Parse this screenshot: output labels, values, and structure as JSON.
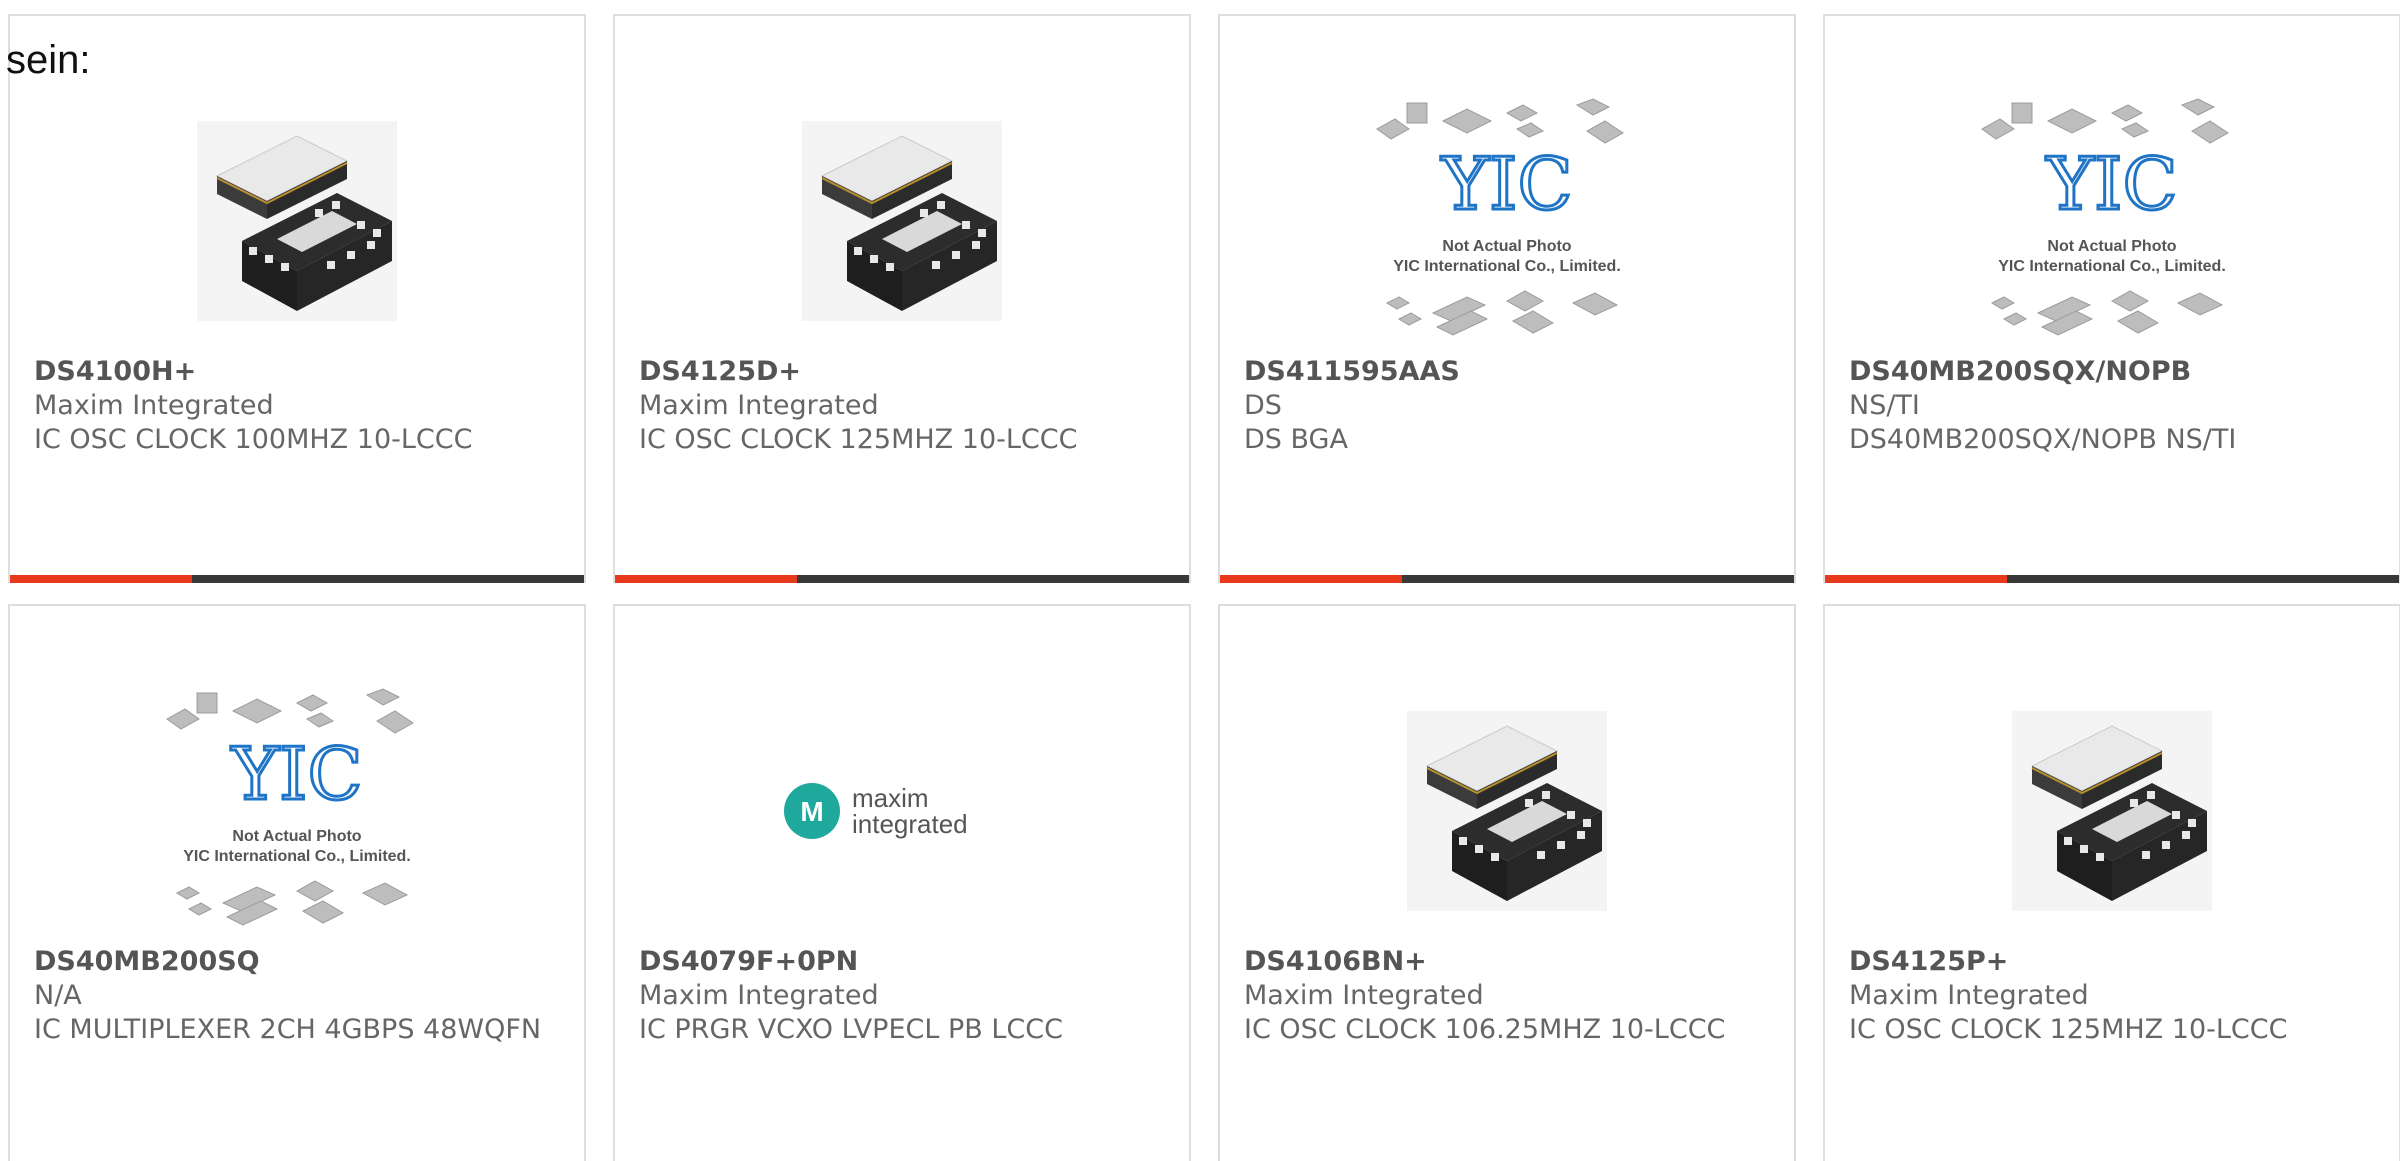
{
  "intro_text": "sein:",
  "products": [
    {
      "part": "DS4100H+",
      "maker": "Maxim Integrated",
      "desc": "IC OSC CLOCK 100MHZ 10-LCCC",
      "image": "chip-lccc"
    },
    {
      "part": "DS4125D+",
      "maker": "Maxim Integrated",
      "desc": "IC OSC CLOCK 125MHZ 10-LCCC",
      "image": "chip-lccc"
    },
    {
      "part": "DS411595AAS",
      "maker": "DS",
      "desc": "DS BGA",
      "image": "yic-placeholder",
      "caption1": "Not Actual Photo",
      "caption2": "YIC International Co., Limited."
    },
    {
      "part": "DS40MB200SQX/NOPB",
      "maker": "NS/TI",
      "desc": "DS40MB200SQX/NOPB NS/TI",
      "image": "yic-placeholder",
      "caption1": "Not Actual Photo",
      "caption2": "YIC International Co., Limited."
    },
    {
      "part": "DS40MB200SQ",
      "maker": "N/A",
      "desc": "IC MULTIPLEXER 2CH 4GBPS 48WQFN",
      "image": "yic-placeholder",
      "caption1": "Not Actual Photo",
      "caption2": "YIC International Co., Limited."
    },
    {
      "part": "DS4079F+0PN",
      "maker": "Maxim Integrated",
      "desc": "IC PRGR VCXO LVPECL PB LCCC",
      "image": "maxim-logo",
      "logo1": "maxim",
      "logo2": "integrated"
    },
    {
      "part": "DS4106BN+",
      "maker": "Maxim Integrated",
      "desc": "IC OSC CLOCK 106.25MHZ 10-LCCC",
      "image": "chip-lccc"
    },
    {
      "part": "DS4125P+",
      "maker": "Maxim Integrated",
      "desc": "IC OSC CLOCK 125MHZ 10-LCCC",
      "image": "chip-lccc"
    }
  ],
  "colors": {
    "accent": "#e8391d",
    "bar": "#383838",
    "yic_blue": "#1f74c6",
    "maxim_teal": "#1fa89c"
  }
}
